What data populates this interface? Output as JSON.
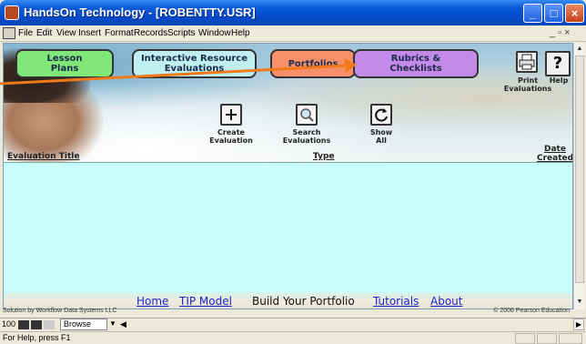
{
  "window": {
    "title": "HandsOn Technology - [ROBENTTY.USR]",
    "controls": {
      "minimize": "_",
      "maximize": "□",
      "close": "×"
    }
  },
  "menu": {
    "items": [
      "File",
      "Edit",
      "View",
      "Insert",
      "Format",
      "Records",
      "Scripts",
      "Window",
      "Help"
    ],
    "mdi_controls": "_ ▫ ×"
  },
  "nav": {
    "lesson_line1": "Lesson",
    "lesson_line2": "Plans",
    "interactive_line1": "Interactive Resource",
    "interactive_line2": "Evaluations",
    "portfolios": "Portfolios",
    "rubrics_line1": "Rubrics &",
    "rubrics_line2": "Checklists"
  },
  "toprightactions": {
    "print_line1": "Print",
    "print_line2": "Evaluations",
    "help": "Help",
    "help_glyph": "?"
  },
  "tools": {
    "create_line1": "Create",
    "create_line2": "Evaluation",
    "search_line1": "Search",
    "search_line2": "Evaluations",
    "show_line1": "Show",
    "show_line2": "All"
  },
  "columns": {
    "title": "Evaluation Title",
    "type": "Type",
    "date_line1": "Date",
    "date_line2": "Created"
  },
  "footer": {
    "home": "Home",
    "tip_model": "TIP Model",
    "build": "Build Your Portfolio",
    "tutorials": "Tutorials",
    "about": "About",
    "credit_left": "Solution by Workflow Data Systems LLC",
    "credit_right": "© 2006 Pearson Education"
  },
  "bottom": {
    "zoom": "100",
    "mode": "Browse"
  },
  "status": {
    "text": "For Help, press F1"
  },
  "colors": {
    "lesson": "#80e878",
    "interactive": "#bfeff0",
    "portfolios": "#f7906a",
    "rubrics": "#c48ae8",
    "list_bg": "#c9fdfd",
    "arrow": "#f07a1a"
  }
}
